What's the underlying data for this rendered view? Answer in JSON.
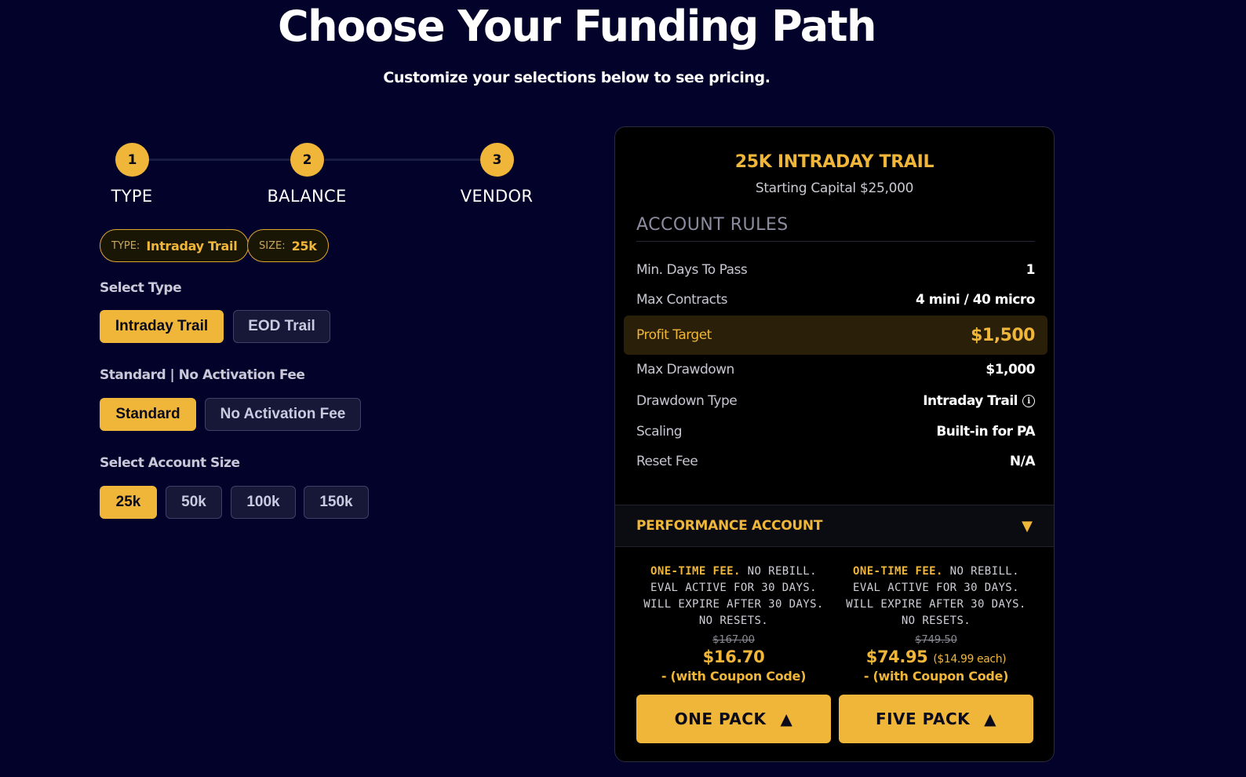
{
  "hero": {
    "title": "Choose Your Funding Path",
    "subtitle": "Customize your selections below to see pricing."
  },
  "stepper": {
    "steps": [
      {
        "number": "1",
        "label": "TYPE"
      },
      {
        "number": "2",
        "label": "BALANCE"
      },
      {
        "number": "3",
        "label": "VENDOR"
      }
    ]
  },
  "chips": [
    {
      "key": "TYPE:",
      "value": "Intraday Trail"
    },
    {
      "key": "SIZE:",
      "value": "25k"
    }
  ],
  "select_type": {
    "label": "Select Type",
    "options": [
      "Intraday Trail",
      "EOD Trail"
    ],
    "selected": "Intraday Trail"
  },
  "fee_type": {
    "label": "Standard | No Activation Fee",
    "options": [
      "Standard",
      "No Activation Fee"
    ],
    "selected": "Standard"
  },
  "account_size": {
    "label": "Select Account Size",
    "options": [
      "25k",
      "50k",
      "100k",
      "150k"
    ],
    "selected": "25k"
  },
  "card": {
    "title": "25K INTRADAY TRAIL",
    "capital": "Starting Capital $25,000",
    "rules_heading": "ACCOUNT RULES",
    "rules": [
      {
        "label": "Min. Days To Pass",
        "value": "1"
      },
      {
        "label": "Max Contracts",
        "value": "4 mini / 40 micro"
      },
      {
        "label": "Profit Target",
        "value": "$1,500"
      },
      {
        "label": "Max Drawdown",
        "value": "$1,000"
      },
      {
        "label": "Drawdown Type",
        "value": "Intraday Trail"
      },
      {
        "label": "Scaling",
        "value": "Built-in for PA"
      },
      {
        "label": "Reset Fee",
        "value": "N/A"
      }
    ],
    "info_icon": "info-icon",
    "performance": {
      "label": "PERFORMANCE ACCOUNT",
      "chevron": "▼"
    },
    "packs": [
      {
        "fee_bold": "ONE-TIME FEE.",
        "fee_rest": " NO REBILL.",
        "fee_line2": "EVAL ACTIVE FOR 30 DAYS.",
        "fee_line3": "WILL EXPIRE AFTER 30 DAYS.",
        "fee_line4": "NO RESETS.",
        "original": "$167.00",
        "price": "$16.70",
        "each": "",
        "coupon": "- (with Coupon Code)",
        "button": "ONE PACK",
        "arrow": "▲"
      },
      {
        "fee_bold": "ONE-TIME FEE.",
        "fee_rest": " NO REBILL.",
        "fee_line2": "EVAL ACTIVE FOR 30 DAYS.",
        "fee_line3": "WILL EXPIRE AFTER 30 DAYS.",
        "fee_line4": "NO RESETS.",
        "original": "$749.50",
        "price": "$74.95",
        "each": "($14.99 each)",
        "coupon": "- (with Coupon Code)",
        "button": "FIVE PACK",
        "arrow": "▲"
      }
    ]
  },
  "colors": {
    "background": "#02022a",
    "accent": "#f0b63a",
    "card": "#000000"
  }
}
